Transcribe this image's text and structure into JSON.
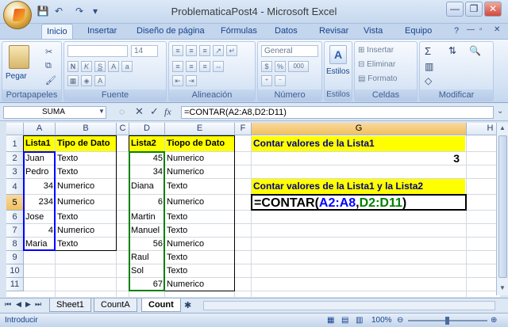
{
  "window": {
    "title": "ProblematicaPost4 - Microsoft Excel",
    "controls": [
      "—",
      "❐",
      "✕"
    ]
  },
  "qat": [
    "💾",
    "↶",
    "↷",
    "▾"
  ],
  "tabs": [
    "Inicio",
    "Insertar",
    "Diseño de página",
    "Fórmulas",
    "Datos",
    "Revisar",
    "Vista",
    "Equipo"
  ],
  "ribbon": {
    "portapapeles": {
      "label": "Portapapeles",
      "paste": "Pegar"
    },
    "fuente": {
      "label": "Fuente",
      "size": "14"
    },
    "alineacion": {
      "label": "Alineación"
    },
    "numero": {
      "label": "Número",
      "format": "General",
      "pct": "%",
      "thousands": "000"
    },
    "estilos": {
      "label": "Estilos",
      "btn": "Estilos"
    },
    "celdas": {
      "label": "Celdas",
      "insertar": "Insertar",
      "eliminar": "Eliminar",
      "formato": "Formato"
    },
    "modificar": {
      "label": "Modificar"
    }
  },
  "formulabar": {
    "namebox": "SUMA",
    "fx": "fx",
    "formula": "=CONTAR(A2:A8,D2:D11)"
  },
  "columns": [
    "A",
    "B",
    "C",
    "D",
    "E",
    "F",
    "G",
    "H"
  ],
  "rows": [
    "1",
    "2",
    "3",
    "4",
    "5",
    "6",
    "7",
    "8",
    "9",
    "10",
    "11"
  ],
  "cells": {
    "A1": "Lista1",
    "B1": "Tipo de Dato",
    "D1": "Lista2",
    "E1": "Tiopo de Dato",
    "A2": "Juan",
    "B2": "Texto",
    "D2": "45",
    "E2": "Numerico",
    "A3": "Pedro",
    "B3": "Texto",
    "D3": "34",
    "E3": "Numerico",
    "A4": "34",
    "B4": "Numerico",
    "D4": "Diana",
    "E4": "Texto",
    "A5": "234",
    "B5": "Numerico",
    "D5": "6",
    "E5": "Numerico",
    "A6": "Jose",
    "B6": "Texto",
    "D6": "Martin",
    "E6": "Texto",
    "A7": "4",
    "B7": "Numerico",
    "D7": "Manuel",
    "E7": "Texto",
    "A8": "Maria",
    "B8": "Texto",
    "D8": "56",
    "E8": "Numerico",
    "D9": "Raul",
    "E9": "Texto",
    "D10": "Sol",
    "E10": "Texto",
    "D11": "67",
    "E11": "Numerico",
    "G1": "Contar valores de la Lista1",
    "G2": "3",
    "G4": "Contar valores de la Lista1 y la Lista2",
    "G5_a": "=CONTAR(",
    "G5_b": "A2:A8",
    ",": ",",
    "G5_c": "D2:D11",
    "G5_d": ")"
  },
  "sheets": [
    "Sheet1",
    "CountA",
    "Count"
  ],
  "status": {
    "mode": "Introducir",
    "zoom": "100%"
  },
  "colors": {
    "yellow": "#ffff00",
    "ref_blue": "#0000ff",
    "ref_green": "#008000"
  }
}
